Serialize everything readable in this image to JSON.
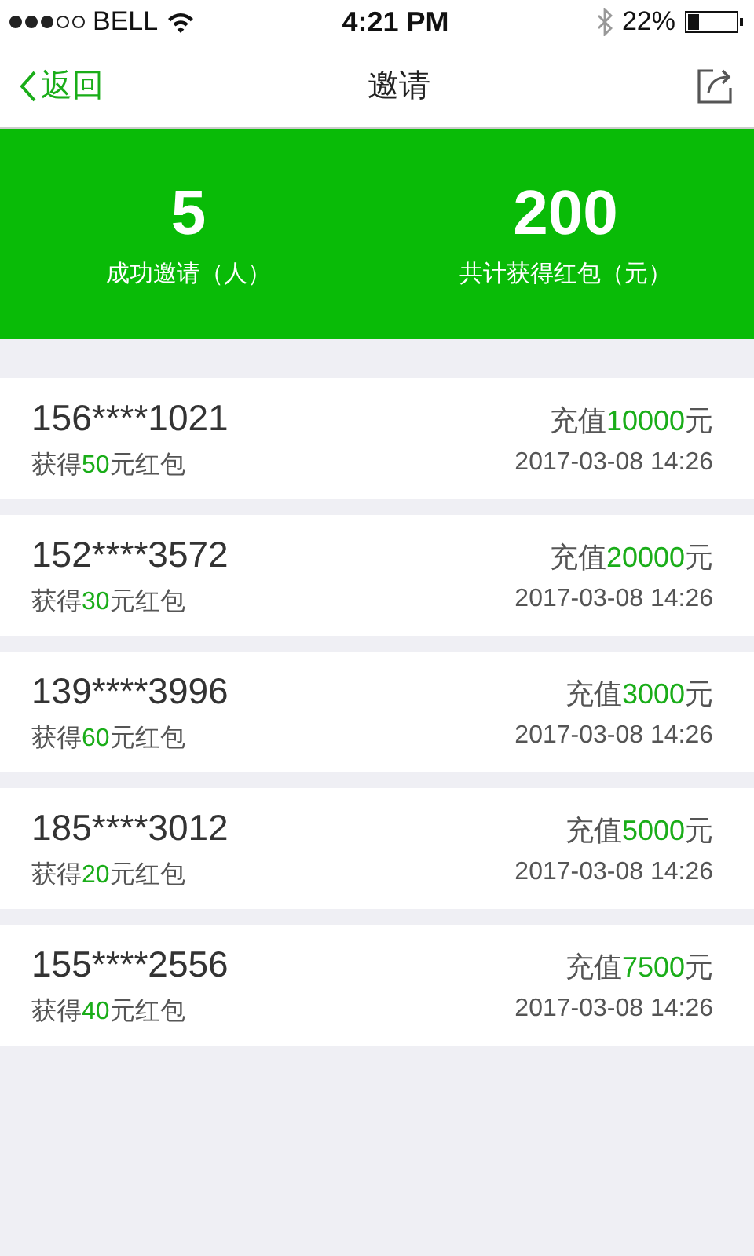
{
  "status_bar": {
    "carrier": "BELL",
    "time": "4:21 PM",
    "battery": "22%"
  },
  "nav": {
    "back": "返回",
    "title": "邀请"
  },
  "summary": [
    {
      "value": "5",
      "label": "成功邀请（人）"
    },
    {
      "value": "200",
      "label": "共计获得红包（元）"
    }
  ],
  "records": [
    {
      "phone": "156****1021",
      "reward_prefix": "获得",
      "reward_amount": "50",
      "reward_suffix": "元红包",
      "recharge_prefix": "充值",
      "recharge_amount": "10000",
      "recharge_suffix": "元",
      "time": "2017-03-08 14:26"
    },
    {
      "phone": "152****3572",
      "reward_prefix": "获得",
      "reward_amount": "30",
      "reward_suffix": "元红包",
      "recharge_prefix": "充值",
      "recharge_amount": "20000",
      "recharge_suffix": "元",
      "time": "2017-03-08 14:26"
    },
    {
      "phone": "139****3996",
      "reward_prefix": "获得",
      "reward_amount": "60",
      "reward_suffix": "元红包",
      "recharge_prefix": "充值",
      "recharge_amount": "3000",
      "recharge_suffix": "元",
      "time": "2017-03-08 14:26"
    },
    {
      "phone": "185****3012",
      "reward_prefix": "获得",
      "reward_amount": "20",
      "reward_suffix": "元红包",
      "recharge_prefix": "充值",
      "recharge_amount": "5000",
      "recharge_suffix": "元",
      "time": "2017-03-08 14:26"
    },
    {
      "phone": "155****2556",
      "reward_prefix": "获得",
      "reward_amount": "40",
      "reward_suffix": "元红包",
      "recharge_prefix": "充值",
      "recharge_amount": "7500",
      "recharge_suffix": "元",
      "time": "2017-03-08 14:26"
    }
  ]
}
